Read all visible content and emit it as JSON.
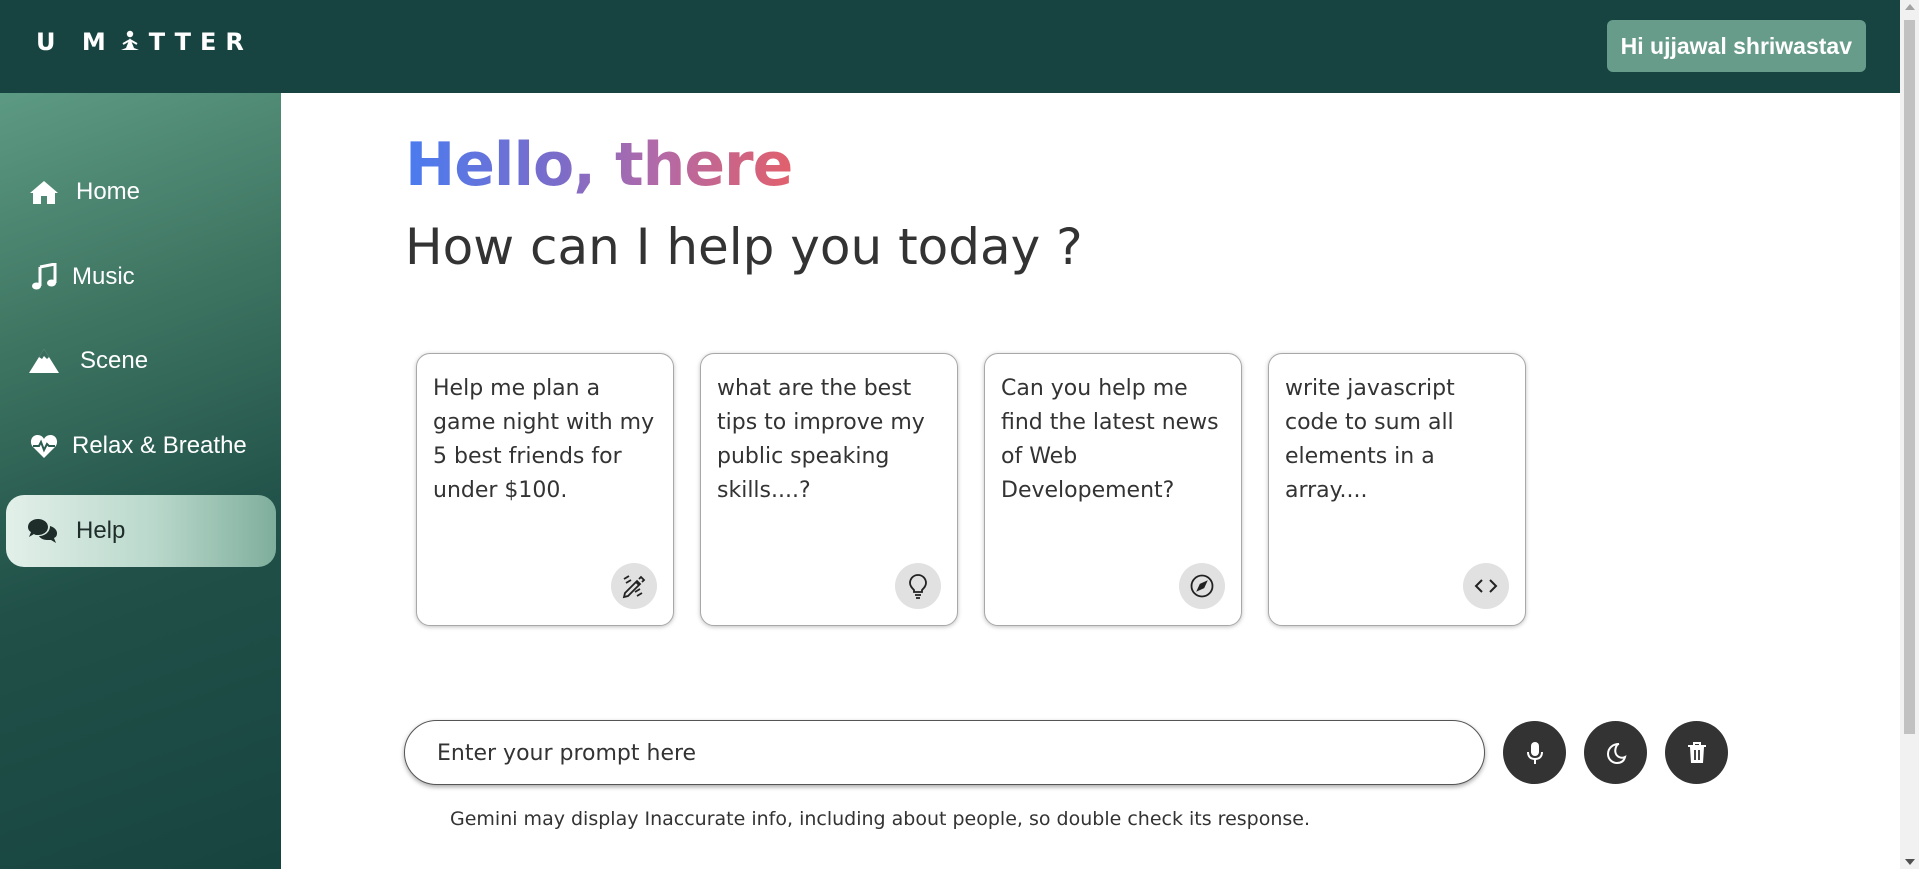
{
  "header": {
    "logo_text_left": "U M",
    "logo_text_right": "TTER",
    "logo_icon": "meditation-icon",
    "user_greeting": "Hi ujjawal shriwastav"
  },
  "sidebar": {
    "items": [
      {
        "label": "Home",
        "icon": "home-icon",
        "active": false
      },
      {
        "label": "Music",
        "icon": "music-note-icon",
        "active": false
      },
      {
        "label": "Scene",
        "icon": "mountain-icon",
        "active": false
      },
      {
        "label": "Relax & Breathe",
        "icon": "heart-pulse-icon",
        "active": false
      },
      {
        "label": "Help",
        "icon": "chat-bubbles-icon",
        "active": true
      }
    ]
  },
  "main": {
    "greeting": "Hello, there",
    "subheading": "How can I help you today ?",
    "suggestions": [
      {
        "text": "Help me plan a game night with my 5 best friends for under $100.",
        "icon": "pencil-ruler-icon"
      },
      {
        "text": "what are the best tips to improve my public speaking skills....?",
        "icon": "lightbulb-icon"
      },
      {
        "text": "Can you help me find the latest news of Web Developement?",
        "icon": "compass-icon"
      },
      {
        "text": "write javascript code to sum all elements in a array....",
        "icon": "code-icon"
      }
    ],
    "prompt": {
      "placeholder": "Enter your prompt here",
      "value": ""
    },
    "actions": [
      {
        "name": "mic",
        "icon": "microphone-icon"
      },
      {
        "name": "theme",
        "icon": "moon-icon"
      },
      {
        "name": "delete",
        "icon": "trash-icon"
      }
    ],
    "disclaimer": "Gemini may display Inaccurate info, including about people, so double check its response."
  },
  "colors": {
    "header_bg": "#174440",
    "greeting_button_bg": "#689c8a",
    "action_button_bg": "#333333",
    "gradient_start": "#4a7cf0",
    "gradient_end": "#e1606c"
  }
}
